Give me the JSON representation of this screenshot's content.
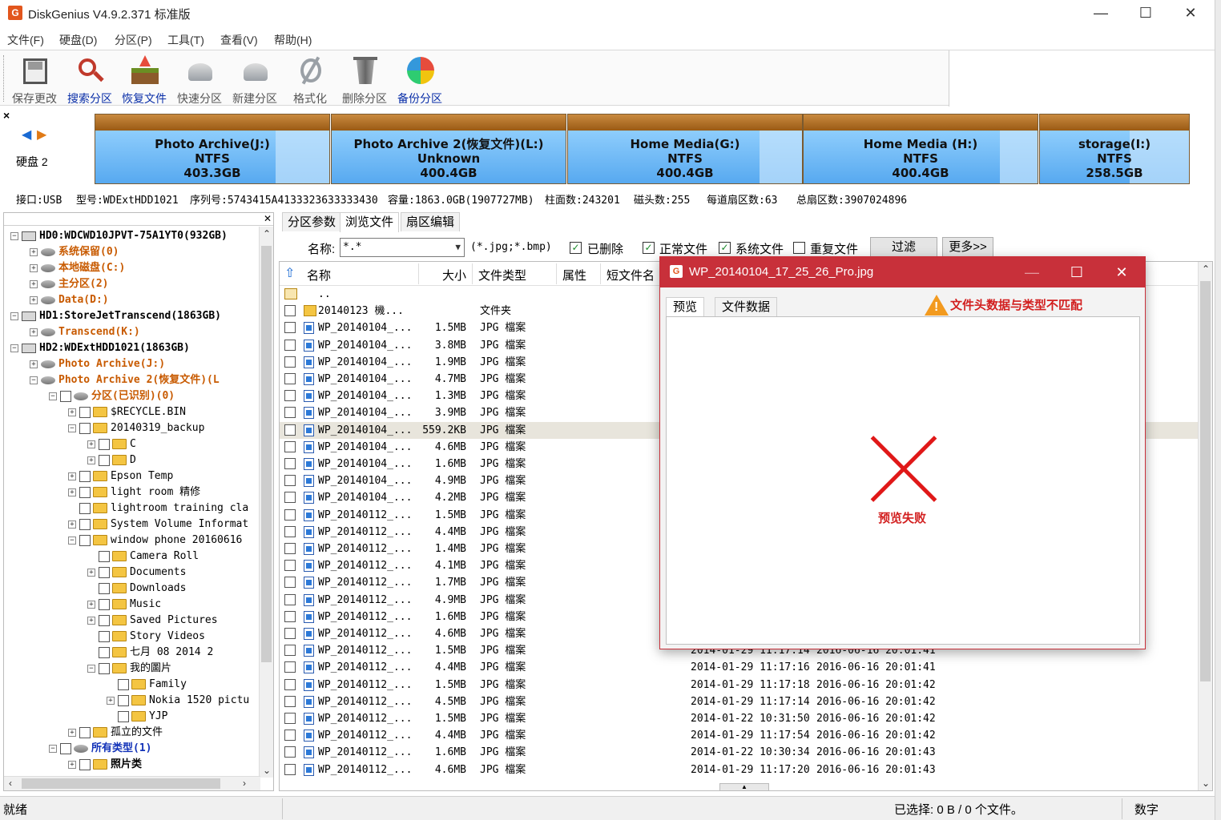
{
  "window": {
    "title": "DiskGenius V4.9.2.371 标准版",
    "icon_letter": "G"
  },
  "menu": [
    "文件(F)",
    "硬盘(D)",
    "分区(P)",
    "工具(T)",
    "查看(V)",
    "帮助(H)"
  ],
  "toolbar": [
    {
      "label": "保存更改",
      "icon": "save-icon",
      "style": "dim"
    },
    {
      "label": "搜索分区",
      "icon": "search-partition-icon",
      "style": "blue"
    },
    {
      "label": "恢复文件",
      "icon": "recover-files-icon",
      "style": "blue"
    },
    {
      "label": "快速分区",
      "icon": "quick-partition-icon",
      "style": "dim"
    },
    {
      "label": "新建分区",
      "icon": "new-partition-icon",
      "style": "dim"
    },
    {
      "label": "格式化",
      "icon": "format-icon",
      "style": "dim"
    },
    {
      "label": "删除分区",
      "icon": "delete-partition-icon",
      "style": "dim"
    },
    {
      "label": "备份分区",
      "icon": "backup-partition-icon",
      "style": "blue"
    }
  ],
  "disk_map": {
    "disk_label": "硬盘 2",
    "partitions": [
      {
        "name": "Photo Archive(J:)",
        "fs": "NTFS",
        "size": "403.3GB",
        "used_fraction": 0.77
      },
      {
        "name": "Photo Archive 2(恢复文件)(L:)",
        "fs": "Unknown",
        "size": "400.4GB",
        "used_fraction": 1.0
      },
      {
        "name": "Home Media(G:)",
        "fs": "NTFS",
        "size": "400.4GB",
        "used_fraction": 0.82
      },
      {
        "name": "Home Media (H:)",
        "fs": "NTFS",
        "size": "400.4GB",
        "used_fraction": 0.84
      },
      {
        "name": "storage(I:)",
        "fs": "NTFS",
        "size": "258.5GB",
        "used_fraction": 0.6
      }
    ]
  },
  "disk_info": {
    "interface": "接口:USB",
    "model": "型号:WDExtHDD1021",
    "serial": "序列号:5743415A4133323633333430",
    "capacity": "容量:1863.0GB(1907727MB)",
    "cylinders": "柱面数:243201",
    "heads": "磁头数:255",
    "sectors_per_track": "每道扇区数:63",
    "total_sectors": "总扇区数:3907024896"
  },
  "tree": [
    {
      "label": "HD0:WDCWD10JPVT-75A1YT0(932GB)",
      "style": "bold",
      "icon": "hdd",
      "exp": "−",
      "chk": false
    },
    {
      "label": "系统保留(0)",
      "style": "orange",
      "icon": "part",
      "exp": "+",
      "chk": false
    },
    {
      "label": "本地磁盘(C:)",
      "style": "orange",
      "icon": "part",
      "exp": "+",
      "chk": false
    },
    {
      "label": "主分区(2)",
      "style": "orange",
      "icon": "part",
      "exp": "+",
      "chk": false
    },
    {
      "label": "Data(D:)",
      "style": "orange",
      "icon": "part",
      "exp": "+",
      "chk": false
    },
    {
      "label": "HD1:StoreJetTranscend(1863GB)",
      "style": "bold",
      "icon": "hdd",
      "exp": "−",
      "chk": false
    },
    {
      "label": "Transcend(K:)",
      "style": "orange",
      "icon": "part",
      "exp": "+",
      "chk": false
    },
    {
      "label": "HD2:WDExtHDD1021(1863GB)",
      "style": "bold",
      "icon": "hdd",
      "exp": "−",
      "chk": false
    },
    {
      "label": "Photo Archive(J:)",
      "style": "orange",
      "icon": "part",
      "exp": "+",
      "chk": false
    },
    {
      "label": "Photo Archive 2(恢复文件)(L",
      "style": "orange",
      "icon": "part",
      "exp": "−",
      "chk": false
    },
    {
      "label": "分区(已识别)(0)",
      "style": "orange",
      "icon": "part",
      "exp": "−",
      "chk": true
    },
    {
      "label": "$RECYCLE.BIN",
      "style": "",
      "icon": "folder",
      "exp": "+",
      "chk": true
    },
    {
      "label": "20140319_backup",
      "style": "",
      "icon": "folder",
      "exp": "−",
      "chk": true
    },
    {
      "label": "C",
      "style": "",
      "icon": "folder",
      "exp": "+",
      "chk": true
    },
    {
      "label": "D",
      "style": "",
      "icon": "folder",
      "exp": "+",
      "chk": true
    },
    {
      "label": "Epson Temp",
      "style": "",
      "icon": "folder",
      "exp": "+",
      "chk": true
    },
    {
      "label": "light room 精修",
      "style": "",
      "icon": "folder",
      "exp": "+",
      "chk": true
    },
    {
      "label": "lightroom training cla",
      "style": "",
      "icon": "folder",
      "exp": "",
      "chk": true
    },
    {
      "label": "System Volume Informat",
      "style": "",
      "icon": "folder",
      "exp": "+",
      "chk": true
    },
    {
      "label": "window phone 20160616",
      "style": "",
      "icon": "folder",
      "exp": "−",
      "chk": true
    },
    {
      "label": "Camera Roll",
      "style": "",
      "icon": "folder",
      "exp": "",
      "chk": true
    },
    {
      "label": "Documents",
      "style": "",
      "icon": "folder",
      "exp": "+",
      "chk": true
    },
    {
      "label": "Downloads",
      "style": "",
      "icon": "folder",
      "exp": "",
      "chk": true
    },
    {
      "label": "Music",
      "style": "",
      "icon": "folder",
      "exp": "+",
      "chk": true
    },
    {
      "label": "Saved Pictures",
      "style": "",
      "icon": "folder",
      "exp": "+",
      "chk": true
    },
    {
      "label": "Story Videos",
      "style": "",
      "icon": "folder",
      "exp": "",
      "chk": true
    },
    {
      "label": "七月 08 2014 2",
      "style": "",
      "icon": "folder",
      "exp": "",
      "chk": true
    },
    {
      "label": "我的圖片",
      "style": "",
      "icon": "folder",
      "exp": "−",
      "chk": true
    },
    {
      "label": "Family",
      "style": "",
      "icon": "folder",
      "exp": "",
      "chk": true
    },
    {
      "label": "Nokia 1520 pictu",
      "style": "",
      "icon": "folder",
      "exp": "+",
      "chk": true
    },
    {
      "label": "YJP",
      "style": "",
      "icon": "folder",
      "exp": "",
      "chk": true
    },
    {
      "label": "孤立的文件",
      "style": "",
      "icon": "folder",
      "exp": "+",
      "chk": true
    },
    {
      "label": "所有类型(1)",
      "style": "blue",
      "icon": "part",
      "exp": "−",
      "chk": true
    },
    {
      "label": "照片类",
      "style": "bold",
      "icon": "folder",
      "exp": "+",
      "chk": true
    }
  ],
  "tabs": [
    "分区参数",
    "浏览文件",
    "扇区编辑"
  ],
  "active_tab": 1,
  "filter": {
    "name_label": "名称:",
    "name_value": "*.*",
    "hint": "(*.jpg;*.bmp)",
    "deleted": {
      "label": "已删除",
      "checked": true
    },
    "normal": {
      "label": "正常文件",
      "checked": true
    },
    "system": {
      "label": "系统文件",
      "checked": true
    },
    "duplicate": {
      "label": "重复文件",
      "checked": false
    },
    "filter_button": "过滤",
    "more_button": "更多>>"
  },
  "columns": {
    "name": "名称",
    "size": "大小",
    "type": "文件类型",
    "attr": "属性",
    "short": "短文件名"
  },
  "files": [
    {
      "name": "..",
      "size": "",
      "type": "",
      "created": "",
      "modified": "",
      "kind": "up"
    },
    {
      "name": "20140123 機...",
      "size": "",
      "type": "文件夹",
      "created": "",
      "modified": "",
      "kind": "dir"
    },
    {
      "name": "WP_20140104_...",
      "size": "1.5MB",
      "type": "JPG 檔案",
      "created": "",
      "modified": "",
      "kind": "file"
    },
    {
      "name": "WP_20140104_...",
      "size": "3.8MB",
      "type": "JPG 檔案",
      "created": "",
      "modified": "",
      "kind": "file"
    },
    {
      "name": "WP_20140104_...",
      "size": "1.9MB",
      "type": "JPG 檔案",
      "created": "",
      "modified": "",
      "kind": "file"
    },
    {
      "name": "WP_20140104_...",
      "size": "4.7MB",
      "type": "JPG 檔案",
      "created": "",
      "modified": "",
      "kind": "file"
    },
    {
      "name": "WP_20140104_...",
      "size": "1.3MB",
      "type": "JPG 檔案",
      "created": "",
      "modified": "",
      "kind": "file"
    },
    {
      "name": "WP_20140104_...",
      "size": "3.9MB",
      "type": "JPG 檔案",
      "created": "",
      "modified": "",
      "kind": "file"
    },
    {
      "name": "WP_20140104_...",
      "size": "559.2KB",
      "type": "JPG 檔案",
      "created": "",
      "modified": "",
      "kind": "file",
      "selected": true
    },
    {
      "name": "WP_20140104_...",
      "size": "4.6MB",
      "type": "JPG 檔案",
      "created": "",
      "modified": "",
      "kind": "file"
    },
    {
      "name": "WP_20140104_...",
      "size": "1.6MB",
      "type": "JPG 檔案",
      "created": "",
      "modified": "",
      "kind": "file"
    },
    {
      "name": "WP_20140104_...",
      "size": "4.9MB",
      "type": "JPG 檔案",
      "created": "",
      "modified": "",
      "kind": "file"
    },
    {
      "name": "WP_20140104_...",
      "size": "4.2MB",
      "type": "JPG 檔案",
      "created": "",
      "modified": "",
      "kind": "file"
    },
    {
      "name": "WP_20140112_...",
      "size": "1.5MB",
      "type": "JPG 檔案",
      "created": "",
      "modified": "",
      "kind": "file"
    },
    {
      "name": "WP_20140112_...",
      "size": "4.4MB",
      "type": "JPG 檔案",
      "created": "",
      "modified": "",
      "kind": "file"
    },
    {
      "name": "WP_20140112_...",
      "size": "1.4MB",
      "type": "JPG 檔案",
      "created": "",
      "modified": "",
      "kind": "file"
    },
    {
      "name": "WP_20140112_...",
      "size": "4.1MB",
      "type": "JPG 檔案",
      "created": "",
      "modified": "",
      "kind": "file"
    },
    {
      "name": "WP_20140112_...",
      "size": "1.7MB",
      "type": "JPG 檔案",
      "created": "",
      "modified": "",
      "kind": "file"
    },
    {
      "name": "WP_20140112_...",
      "size": "4.9MB",
      "type": "JPG 檔案",
      "created": "",
      "modified": "",
      "kind": "file"
    },
    {
      "name": "WP_20140112_...",
      "size": "1.6MB",
      "type": "JPG 檔案",
      "created": "",
      "modified": "",
      "kind": "file"
    },
    {
      "name": "WP_20140112_...",
      "size": "4.6MB",
      "type": "JPG 檔案",
      "created": "",
      "modified": "",
      "kind": "file"
    },
    {
      "name": "WP_20140112_...",
      "size": "1.5MB",
      "type": "JPG 檔案",
      "created": "2014-01-29 11:17:14",
      "modified": "2016-06-16 20:01:41",
      "kind": "file"
    },
    {
      "name": "WP_20140112_...",
      "size": "4.4MB",
      "type": "JPG 檔案",
      "created": "2014-01-29 11:17:16",
      "modified": "2016-06-16 20:01:41",
      "kind": "file"
    },
    {
      "name": "WP_20140112_...",
      "size": "1.5MB",
      "type": "JPG 檔案",
      "created": "2014-01-29 11:17:18",
      "modified": "2016-06-16 20:01:42",
      "kind": "file"
    },
    {
      "name": "WP_20140112_...",
      "size": "4.5MB",
      "type": "JPG 檔案",
      "created": "2014-01-29 11:17:14",
      "modified": "2016-06-16 20:01:42",
      "kind": "file"
    },
    {
      "name": "WP_20140112_...",
      "size": "1.5MB",
      "type": "JPG 檔案",
      "created": "2014-01-22 10:31:50",
      "modified": "2016-06-16 20:01:42",
      "kind": "file"
    },
    {
      "name": "WP_20140112_...",
      "size": "4.4MB",
      "type": "JPG 檔案",
      "created": "2014-01-29 11:17:54",
      "modified": "2016-06-16 20:01:42",
      "kind": "file"
    },
    {
      "name": "WP_20140112_...",
      "size": "1.6MB",
      "type": "JPG 檔案",
      "created": "2014-01-22 10:30:34",
      "modified": "2016-06-16 20:01:43",
      "kind": "file"
    },
    {
      "name": "WP_20140112_...",
      "size": "4.6MB",
      "type": "JPG 檔案",
      "created": "2014-01-29 11:17:20",
      "modified": "2016-06-16 20:01:43",
      "kind": "file"
    }
  ],
  "preview_dialog": {
    "title": "WP_20140104_17_25_26_Pro.jpg",
    "tab_preview": "预览",
    "tab_data": "文件数据",
    "warning": "文件头数据与类型不匹配",
    "fail_text": "预览失败"
  },
  "status": {
    "left": "就绪",
    "selection": "已选择: 0 B / 0 个文件。",
    "mode": "数字"
  }
}
